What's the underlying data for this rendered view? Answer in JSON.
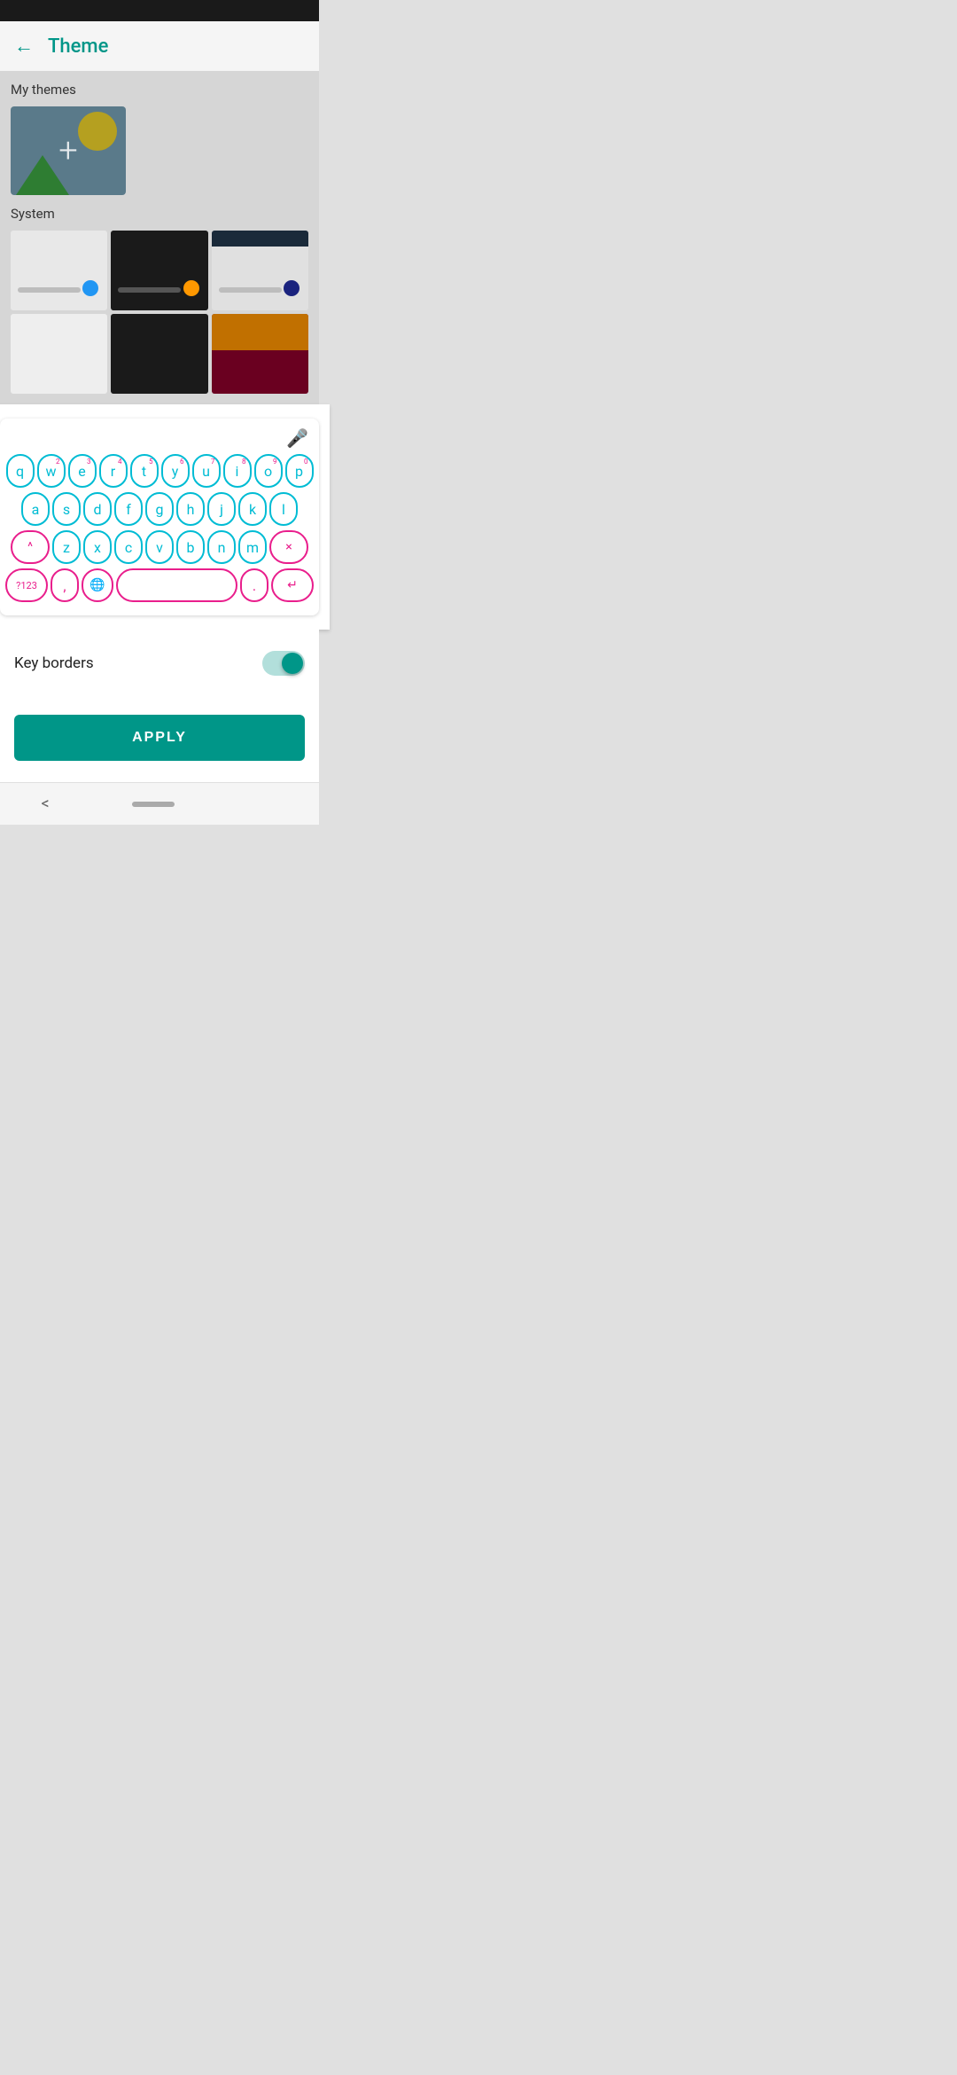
{
  "statusBar": {},
  "topBar": {
    "backLabel": "←",
    "title": "Theme"
  },
  "content": {
    "myThemesLabel": "My themes",
    "systemLabel": "System",
    "addThemeCard": {
      "plus": "+"
    }
  },
  "keyboard": {
    "micIcon": "🎤",
    "rows": [
      {
        "keys": [
          {
            "label": "q",
            "hint": ""
          },
          {
            "label": "w",
            "hint": "2"
          },
          {
            "label": "e",
            "hint": "3"
          },
          {
            "label": "r",
            "hint": "4"
          },
          {
            "label": "t",
            "hint": "5"
          },
          {
            "label": "y",
            "hint": "6"
          },
          {
            "label": "u",
            "hint": "7"
          },
          {
            "label": "i",
            "hint": "8"
          },
          {
            "label": "o",
            "hint": "9"
          },
          {
            "label": "p",
            "hint": "0"
          }
        ]
      },
      {
        "keys": [
          {
            "label": "a"
          },
          {
            "label": "s"
          },
          {
            "label": "d"
          },
          {
            "label": "f"
          },
          {
            "label": "g"
          },
          {
            "label": "h"
          },
          {
            "label": "j"
          },
          {
            "label": "k"
          },
          {
            "label": "l"
          }
        ]
      },
      {
        "special": true,
        "shift": "^",
        "keys": [
          {
            "label": "z"
          },
          {
            "label": "x"
          },
          {
            "label": "c"
          },
          {
            "label": "v"
          },
          {
            "label": "b"
          },
          {
            "label": "n"
          },
          {
            "label": "m"
          }
        ],
        "backspace": "×"
      },
      {
        "bottom": true,
        "numSwitch": "?123",
        "comma": ",",
        "globe": "🌐",
        "space": "",
        "period": ".",
        "enter": "↵"
      }
    ]
  },
  "keyBorders": {
    "label": "Key borders",
    "enabled": true
  },
  "applyButton": {
    "label": "APPLY"
  },
  "navBar": {
    "back": "<",
    "homePill": ""
  }
}
